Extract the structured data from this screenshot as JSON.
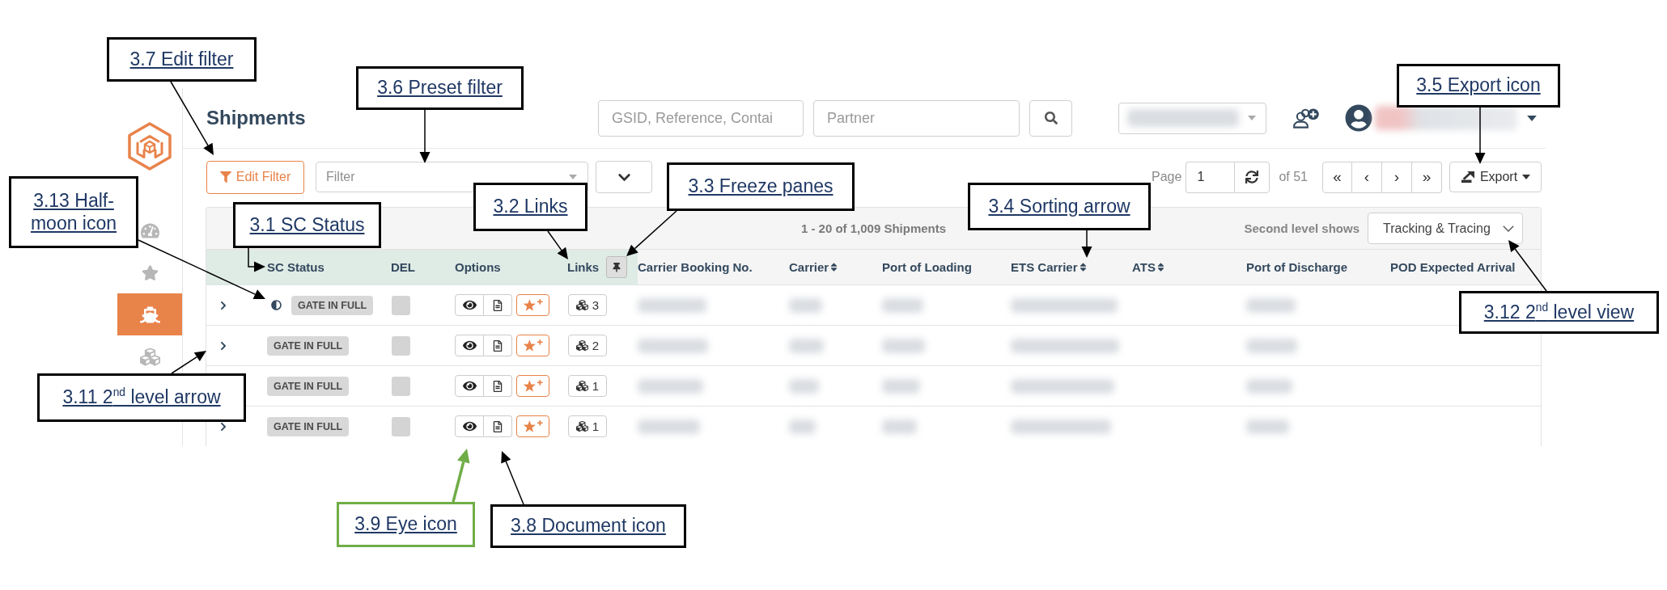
{
  "sidebar": {
    "items": [
      {
        "kind": "gauge",
        "selected": false
      },
      {
        "kind": "star",
        "selected": false
      },
      {
        "kind": "ship",
        "selected": true
      },
      {
        "kind": "cubes",
        "selected": false
      }
    ]
  },
  "header": {
    "title": "Shipments",
    "search_fields": [
      {
        "placeholder": "GSID, Reference, Contai"
      },
      {
        "placeholder": "Partner"
      }
    ]
  },
  "toolbar": {
    "edit_filter": "Edit Filter",
    "preset_filter": {
      "placeholder": "Filter"
    },
    "page_label": "Page",
    "page": "1",
    "page_count": "of 51",
    "pager": [
      "«",
      "‹",
      "›",
      "»"
    ],
    "export": "Export"
  },
  "table": {
    "summary": "1 - 20 of 1,009 Shipments",
    "second_level": {
      "label": "Second level shows",
      "value": "Tracking & Tracing"
    },
    "columns": [
      {
        "label": "SC Status",
        "kind": "status",
        "sortable": false,
        "frozen": true,
        "blurred": false
      },
      {
        "label": "DEL",
        "kind": "del",
        "sortable": false,
        "frozen": true,
        "blurred": false
      },
      {
        "label": "Options",
        "kind": "options",
        "sortable": false,
        "frozen": true,
        "blurred": false
      },
      {
        "label": "Links",
        "kind": "links",
        "sortable": false,
        "frozen": true,
        "blurred": false
      },
      {
        "label": "Carrier Booking No.",
        "kind": "text",
        "sortable": false,
        "frozen": false,
        "blurred": true
      },
      {
        "label": "Carrier",
        "kind": "text",
        "sortable": true,
        "frozen": false,
        "blurred": true
      },
      {
        "label": "Port of Loading",
        "kind": "text",
        "sortable": false,
        "frozen": false,
        "blurred": true
      },
      {
        "label": "ETS Carrier",
        "kind": "text",
        "sortable": true,
        "frozen": false,
        "blurred": true
      },
      {
        "label": "ATS",
        "kind": "text",
        "sortable": true,
        "frozen": false,
        "blurred": false
      },
      {
        "label": "Port of Discharge",
        "kind": "text",
        "sortable": false,
        "frozen": false,
        "blurred": true
      },
      {
        "label": "POD Expected Arrival",
        "kind": "text",
        "sortable": false,
        "frozen": false,
        "blurred": false
      }
    ],
    "rows": [
      {
        "expanded": false,
        "half_moon": true,
        "status": "GATE IN FULL",
        "del": false,
        "links": "3"
      },
      {
        "expanded": false,
        "half_moon": false,
        "status": "GATE IN FULL",
        "del": false,
        "links": "2"
      },
      {
        "half_moon": false,
        "status": "GATE IN FULL",
        "del": false,
        "links": "1"
      },
      {
        "expanded": false,
        "half_moon": false,
        "status": "GATE IN FULL",
        "del": false,
        "links": "1"
      }
    ]
  },
  "annotations": [
    {
      "label": "3.7 Edit filter",
      "color": "#000000"
    },
    {
      "label": "3.6 Preset filter",
      "color": "#000000"
    },
    {
      "label": "3.5 Export icon",
      "color": "#000000"
    },
    {
      "label": "3.13 Half-moon icon",
      "color": "#000000"
    },
    {
      "label": "3.1 SC Status",
      "color": "#000000"
    },
    {
      "label": "3.2 Links",
      "color": "#000000"
    },
    {
      "label": "3.3 Freeze panes",
      "color": "#000000"
    },
    {
      "label": "3.4 Sorting arrow",
      "color": "#000000"
    },
    {
      "label": "3.12 2$^{nd}$ level view",
      "color": "#000000"
    },
    {
      "label": "3.11 2$^{nd}$ level arrow",
      "color": "#000000"
    },
    {
      "label": "3.9 Eye icon",
      "color": "#70ad47"
    },
    {
      "label": "3.8 Document icon",
      "color": "#000000"
    }
  ]
}
